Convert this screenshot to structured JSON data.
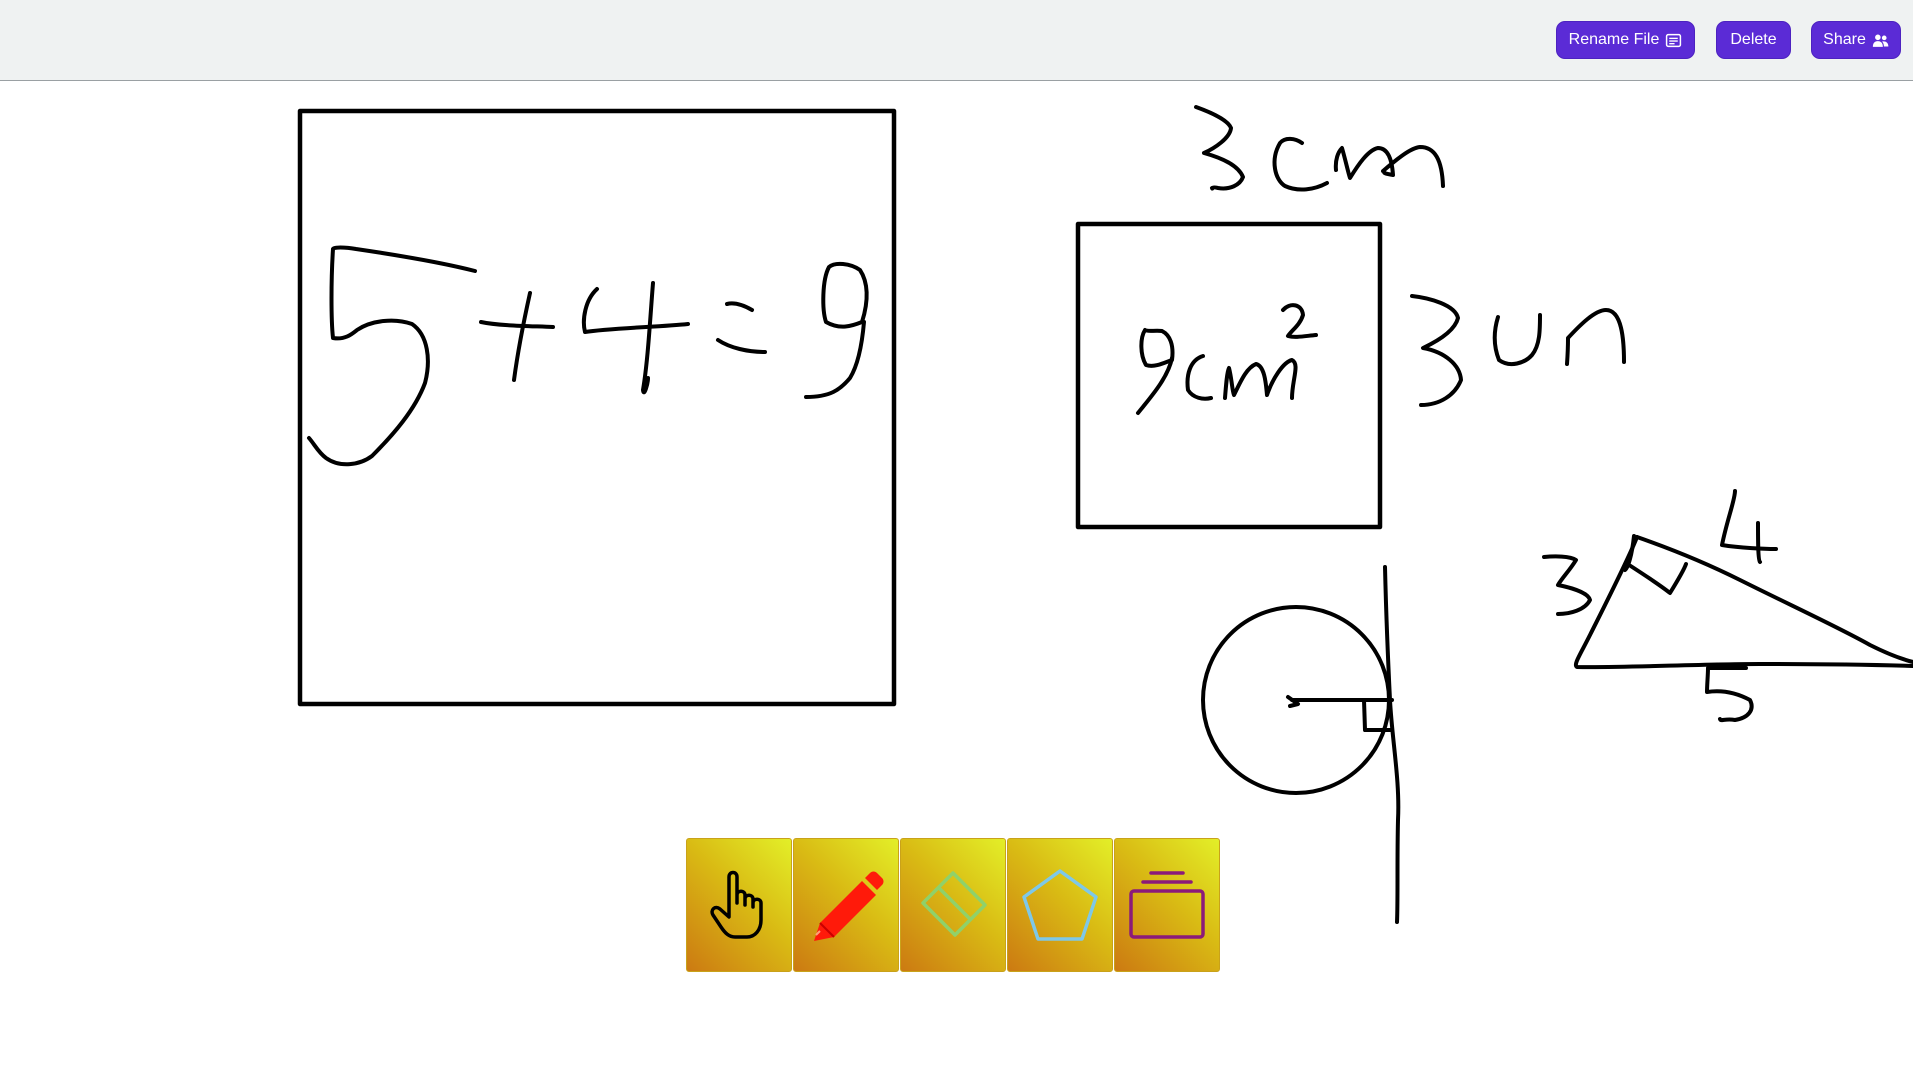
{
  "header": {
    "rename_label": "Rename File",
    "delete_label": "Delete",
    "share_label": "Share",
    "rename_icon": "document-lines-icon",
    "share_icon": "people-icon",
    "button_color": "#5b2bd6"
  },
  "toolbar": {
    "tools": [
      {
        "name": "hand",
        "icon": "hand-pointer-icon",
        "color": "#000000"
      },
      {
        "name": "pencil",
        "icon": "pencil-icon",
        "color": "#ff0000"
      },
      {
        "name": "eraser",
        "icon": "eraser-icon",
        "color": "#8fd16a"
      },
      {
        "name": "shapes",
        "icon": "pentagon-icon",
        "color": "#7ec8e8"
      },
      {
        "name": "layers",
        "icon": "stack-icon",
        "color": "#8b1a7a"
      }
    ]
  },
  "drawing": {
    "stroke_color": "#000000"
  }
}
